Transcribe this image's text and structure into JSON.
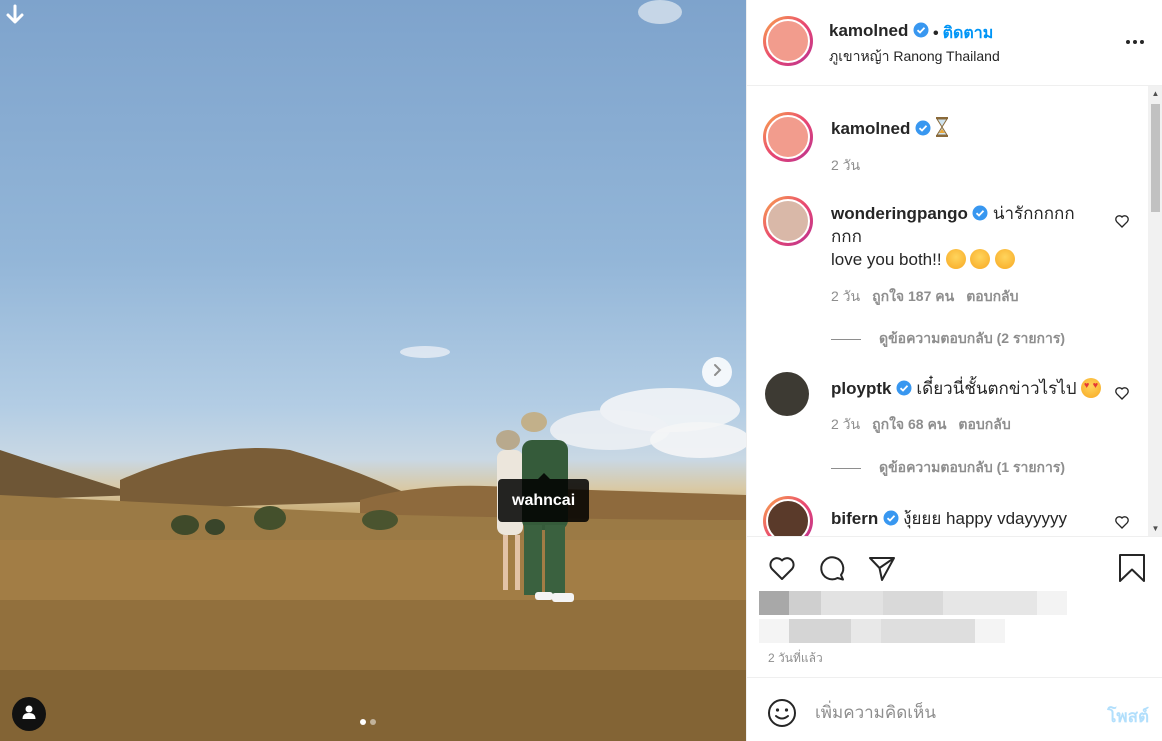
{
  "post": {
    "username": "kamolned",
    "follow_label": "ติดตาม",
    "separator": "•",
    "location": "ภูเขาหญ้า Ranong Thailand",
    "photo_tag": "wahncai"
  },
  "caption": {
    "username": "kamolned",
    "time": "2 วัน"
  },
  "comments": [
    {
      "username": "wonderingpango",
      "text": "น่ารักกกกก",
      "text2": "กกก",
      "text3": "love you both!!",
      "time": "2 วัน",
      "likes": "ถูกใจ 187 คน",
      "reply": "ตอบกลับ",
      "view_replies": "ดูข้อความตอบกลับ (2 รายการ)"
    },
    {
      "username": "ployptk",
      "text": "เดี๋ยวนี่ชั้นตกข่าวไรไป",
      "time": "2 วัน",
      "likes": "ถูกใจ 68 คน",
      "reply": "ตอบกลับ",
      "view_replies": "ดูข้อความตอบกลับ (1 รายการ)"
    },
    {
      "username": "bifern",
      "text": "งุ้ยยย happy vdayyyyy"
    }
  ],
  "footer": {
    "time_ago": "2 วันที่แล้ว",
    "comment_placeholder": "เพิ่มความคิดเห็น",
    "post_label": "โพสต์"
  },
  "colors": {
    "accent": "#0095f6",
    "post_disabled": "#b2dffc",
    "verified": "#3897f0"
  },
  "icons": [
    "download-icon",
    "next-arrow-icon",
    "user-tag-icon",
    "more-icon",
    "verified-icon",
    "heart-icon",
    "comment-icon",
    "share-icon",
    "bookmark-icon",
    "smile-icon",
    "hourglass-icon"
  ]
}
